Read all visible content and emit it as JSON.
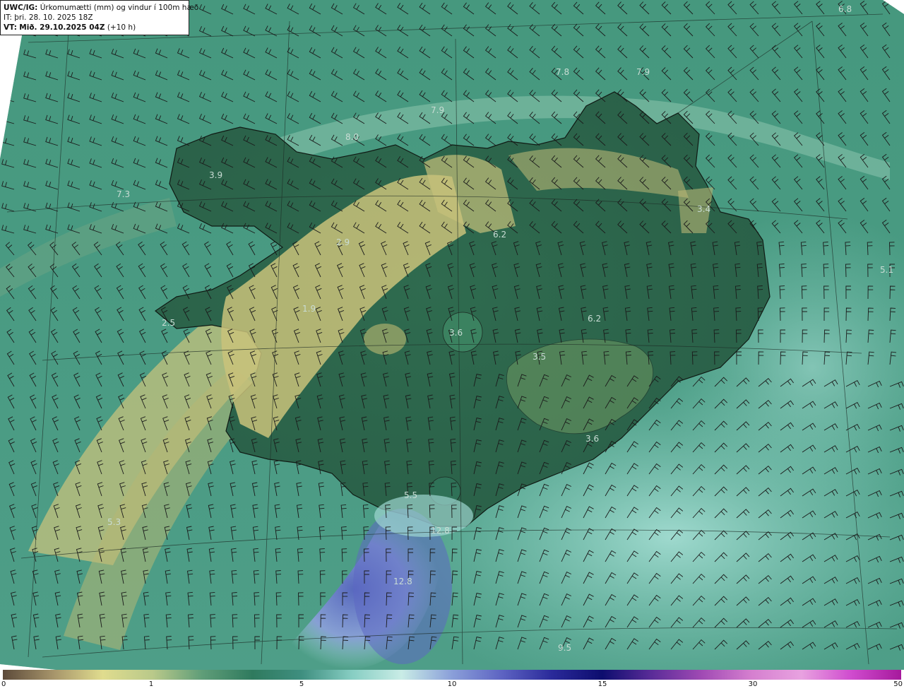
{
  "header": {
    "model_label": "UWC/IG:",
    "title": "Úrkomumætti (mm) og vindur í 100m hæð",
    "it_label": "IT:",
    "it_value": "þri. 28. 10. 2025 18Z",
    "vt_label": "VT:",
    "vt_value": "Mið. 29.10.2025 04Z",
    "vt_offset": "(+10 h)"
  },
  "map": {
    "values": [
      {
        "label": "6.8"
      },
      {
        "label": "7.8"
      },
      {
        "label": "7.9"
      },
      {
        "label": "7.9"
      },
      {
        "label": "8.0"
      },
      {
        "label": "3.9"
      },
      {
        "label": "7.3"
      },
      {
        "label": "3.4"
      },
      {
        "label": "6.2"
      },
      {
        "label": "2.9"
      },
      {
        "label": "5.1"
      },
      {
        "label": "1.9"
      },
      {
        "label": "2.5"
      },
      {
        "label": "3.6"
      },
      {
        "label": "6.2"
      },
      {
        "label": "3.5"
      },
      {
        "label": "3.6"
      },
      {
        "label": "5.5"
      },
      {
        "label": "12.8"
      },
      {
        "label": "5.3"
      },
      {
        "label": "12.8"
      },
      {
        "label": "9.5"
      }
    ],
    "land_color": "#2e6a4c",
    "sea_color": "#3f8f78",
    "precip_high_color": "#6673c4"
  },
  "colorbar": {
    "ticks": [
      "0",
      "1",
      "5",
      "10",
      "15",
      "30",
      "50"
    ],
    "colors": [
      "#5c4a3a",
      "#a6946a",
      "#e0dc8e",
      "#b9c98a",
      "#5f9d78",
      "#2f7a5e",
      "#3f8f80",
      "#87cec3",
      "#c9ece6",
      "#8a9fd9",
      "#5d63c2",
      "#2a2a9a",
      "#0d0d6e",
      "#5a2c98",
      "#a04ab4",
      "#d57fcf",
      "#e8a2e0",
      "#d04ccf",
      "#a6199c"
    ]
  }
}
